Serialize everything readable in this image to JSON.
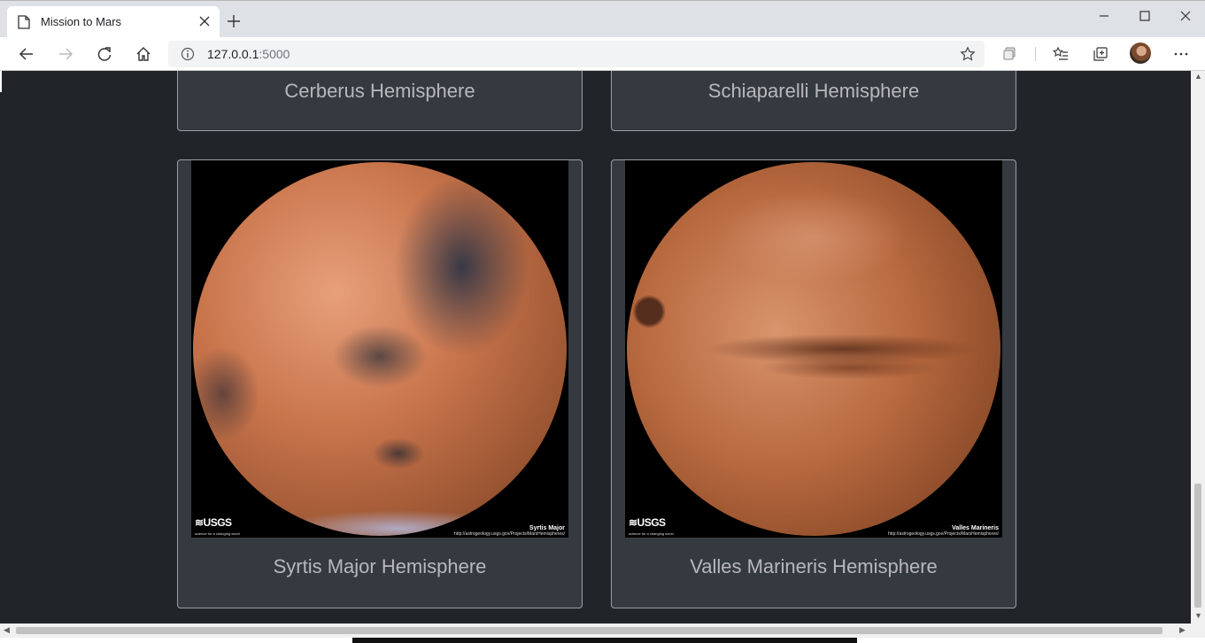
{
  "browser": {
    "tab_title": "Mission to Mars",
    "url_host": "127.0.0.1",
    "url_port": ":5000"
  },
  "cards": [
    {
      "caption": "Cerberus Hemisphere"
    },
    {
      "caption": "Schiaparelli Hemisphere"
    },
    {
      "caption": "Syrtis Major Hemisphere",
      "image": {
        "logo": "≋USGS",
        "tagline": "science for a changing world",
        "map_name": "Syrtis Major",
        "map_url": "http://astrogeology.usgs.gov/Projects/MarsHemispheres/"
      }
    },
    {
      "caption": "Valles Marineris Hemisphere",
      "image": {
        "logo": "≋USGS",
        "tagline": "science for a changing world",
        "map_name": "Valles Marineris",
        "map_url": "http://astrogeology.usgs.gov/Projects/MarsHemispheres/"
      }
    }
  ],
  "colors": {
    "page_bg": "#212529",
    "card_bg": "#343a40",
    "caption_text": "#b8b8bc"
  }
}
